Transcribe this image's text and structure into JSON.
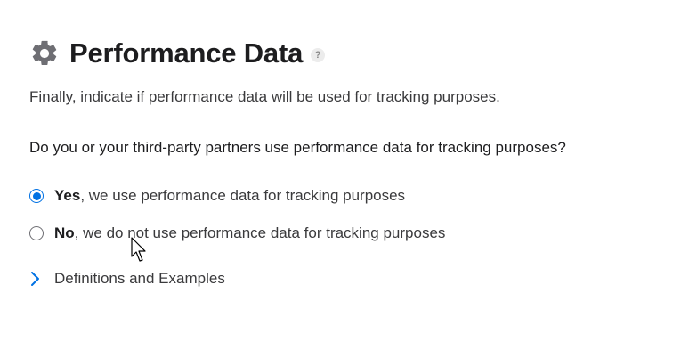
{
  "section": {
    "title": "Performance Data",
    "help_label": "?",
    "intro": "Finally, indicate if performance data will be used for tracking purposes.",
    "question": "Do you or your third-party partners use performance data for tracking purposes?"
  },
  "options": [
    {
      "label_bold": "Yes",
      "label_rest": ", we use performance data for tracking purposes",
      "selected": true
    },
    {
      "label_bold": "No",
      "label_rest": ", we do not use performance data for tracking purposes",
      "selected": false
    }
  ],
  "disclosure": {
    "label": "Definitions and Examples",
    "icon": "chevron-right-icon"
  },
  "icons": {
    "header": "gear-icon"
  },
  "colors": {
    "accent": "#0071e3",
    "text": "#1d1d1f",
    "secondary_text": "#3a3a3c"
  }
}
